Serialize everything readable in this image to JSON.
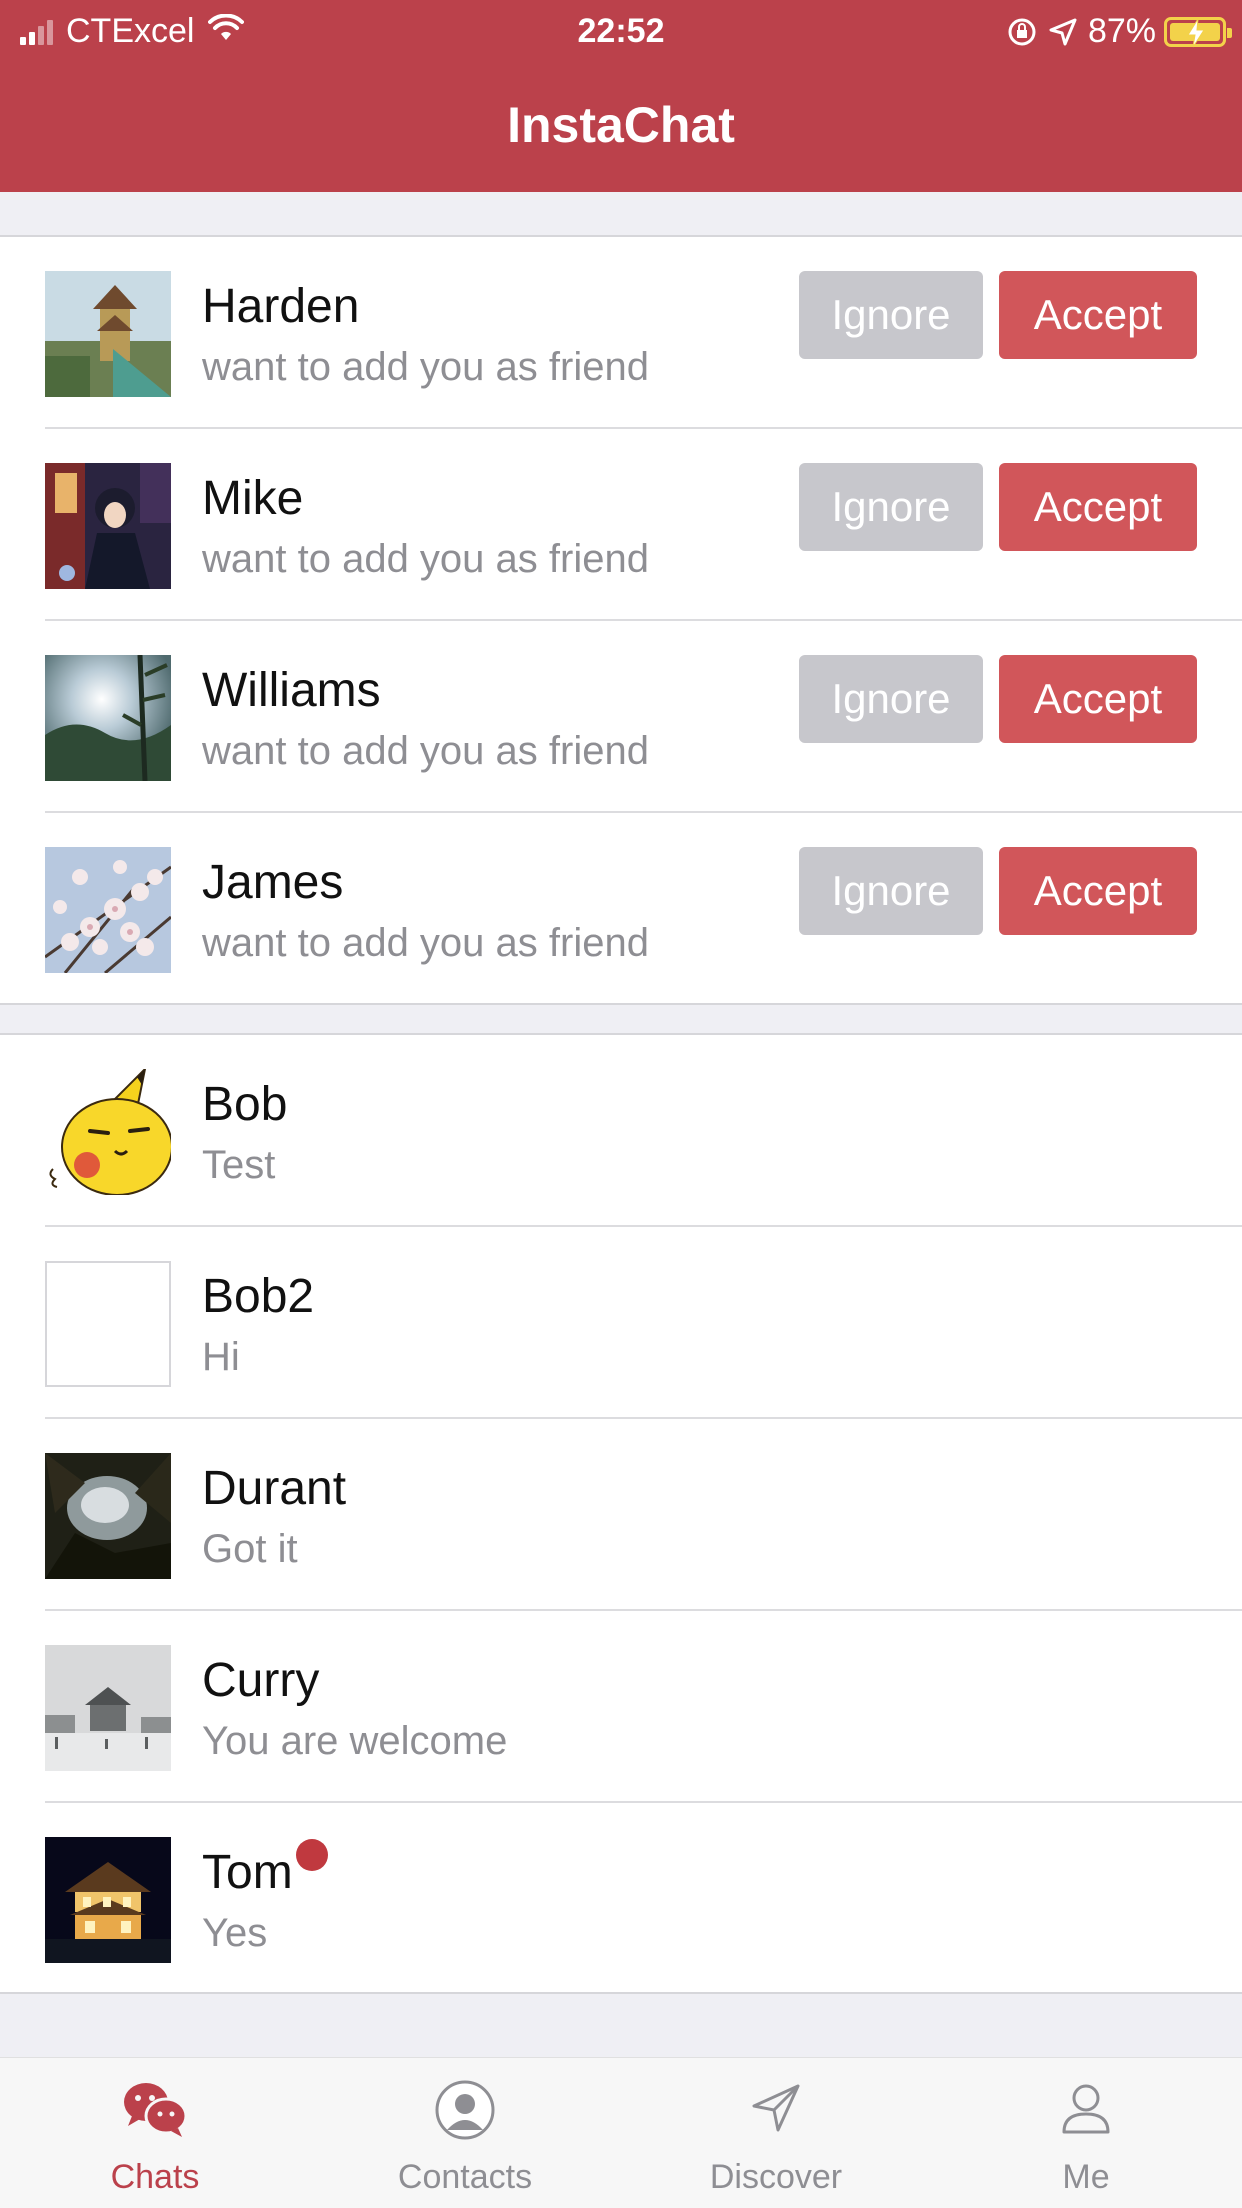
{
  "status_bar": {
    "carrier": "CTExcel",
    "time": "22:52",
    "battery_percent": "87%"
  },
  "header": {
    "title": "InstaChat"
  },
  "friend_requests": [
    {
      "name": "Harden",
      "message": "want to add you as friend",
      "ignore_label": "Ignore",
      "accept_label": "Accept"
    },
    {
      "name": "Mike",
      "message": "want to add you as friend",
      "ignore_label": "Ignore",
      "accept_label": "Accept"
    },
    {
      "name": "Williams",
      "message": "want to add you as friend",
      "ignore_label": "Ignore",
      "accept_label": "Accept"
    },
    {
      "name": "James",
      "message": "want to add you as friend",
      "ignore_label": "Ignore",
      "accept_label": "Accept"
    }
  ],
  "chats": [
    {
      "name": "Bob",
      "last_message": "Test"
    },
    {
      "name": "Bob2",
      "last_message": "Hi"
    },
    {
      "name": "Durant",
      "last_message": "Got it"
    },
    {
      "name": "Curry",
      "last_message": "You are welcome"
    },
    {
      "name": "Tom",
      "last_message": "Yes",
      "unread": true
    }
  ],
  "tabs": [
    {
      "label": "Chats",
      "icon": "chat-bubbles-icon",
      "active": true
    },
    {
      "label": "Contacts",
      "icon": "contact-person-icon",
      "active": false
    },
    {
      "label": "Discover",
      "icon": "paper-plane-icon",
      "active": false
    },
    {
      "label": "Me",
      "icon": "user-outline-icon",
      "active": false
    }
  ],
  "colors": {
    "brand": "#bb414b",
    "accept": "#d1565a",
    "ignore": "#c7c7cc",
    "badge": "#c0393f"
  }
}
